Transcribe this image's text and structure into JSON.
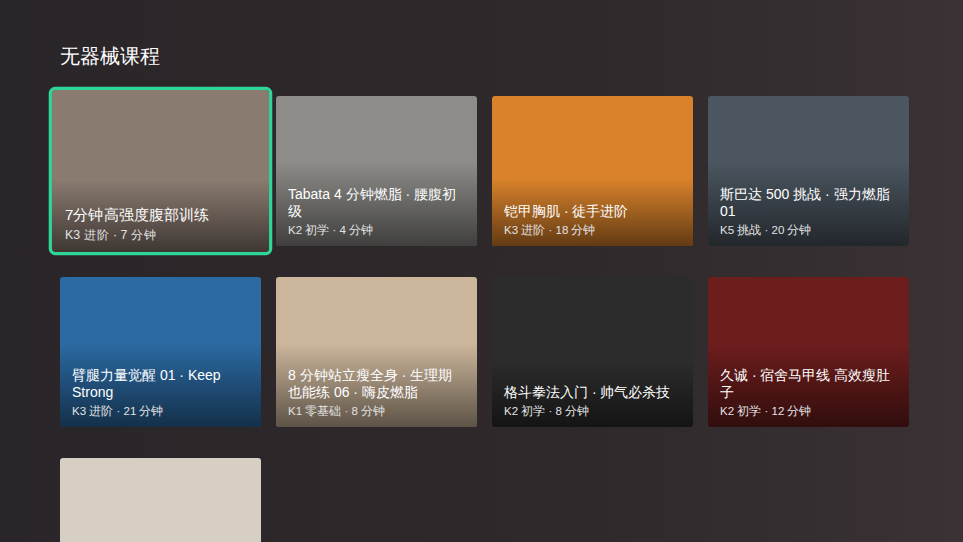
{
  "section": {
    "title": "无器械课程"
  },
  "courses": [
    {
      "title": "7分钟高强度腹部训练",
      "meta": "K3 进阶 · 7 分钟",
      "selected": true,
      "color": "#8a7b70"
    },
    {
      "title": "Tabata 4 分钟燃脂 · 腰腹初级",
      "meta": "K2 初学 · 4 分钟",
      "selected": false,
      "color": "#8d8c88"
    },
    {
      "title": "铠甲胸肌 · 徒手进阶",
      "meta": "K3 进阶 · 18 分钟",
      "selected": false,
      "color": "#d9822b"
    },
    {
      "title": "斯巴达 500 挑战 · 强力燃脂 01",
      "meta": "K5 挑战 · 20 分钟",
      "selected": false,
      "color": "#4b5660"
    },
    {
      "title": "臂腿力量觉醒 01 · Keep Strong",
      "meta": "K3 进阶 · 21 分钟",
      "selected": false,
      "color": "#2b6aa3"
    },
    {
      "title": "8 分钟站立瘦全身 · 生理期也能练 06 · 嗨皮燃脂",
      "meta": "K1 零基础 · 8 分钟",
      "selected": false,
      "color": "#cdb79c"
    },
    {
      "title": "格斗拳法入门 · 帅气必杀技",
      "meta": "K2 初学 · 8 分钟",
      "selected": false,
      "color": "#2c2c2c"
    },
    {
      "title": "久诚 · 宿舍马甲线 高效瘦肚子",
      "meta": "K2 初学 · 12 分钟",
      "selected": false,
      "color": "#6e1d1d"
    },
    {
      "title": "",
      "meta": "",
      "selected": false,
      "color": "#d8cfc4"
    }
  ]
}
